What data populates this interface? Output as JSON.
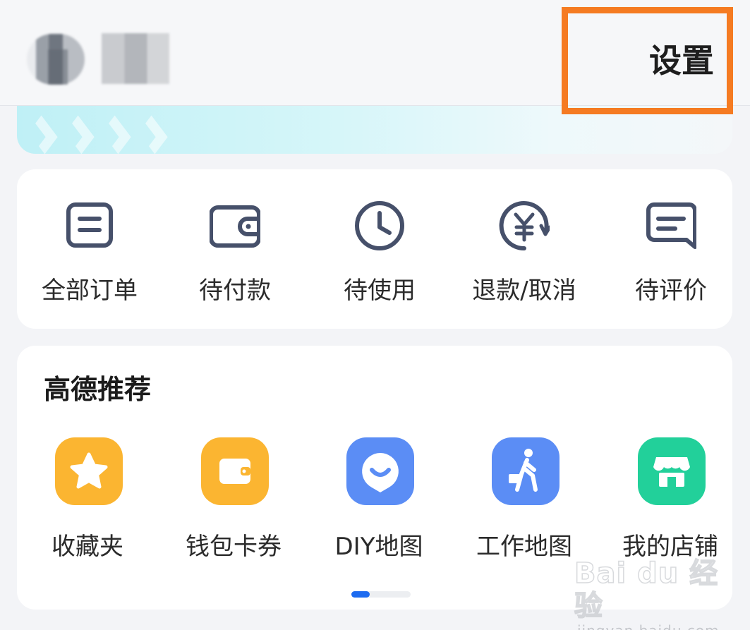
{
  "header": {
    "settings_label": "设置"
  },
  "orders": {
    "items": [
      {
        "label": "全部订单",
        "icon": "order-list-icon"
      },
      {
        "label": "待付款",
        "icon": "wallet-icon"
      },
      {
        "label": "待使用",
        "icon": "clock-icon"
      },
      {
        "label": "退款/取消",
        "icon": "yuan-refund-icon"
      },
      {
        "label": "待评价",
        "icon": "comment-icon"
      }
    ]
  },
  "recommend": {
    "title": "高德推荐",
    "items": [
      {
        "label": "收藏夹",
        "icon": "star-icon",
        "color": "#fbb531"
      },
      {
        "label": "钱包卡券",
        "icon": "wallet-card-icon",
        "color": "#fbb531"
      },
      {
        "label": "DIY地图",
        "icon": "smile-pin-icon",
        "color": "#5b8df5"
      },
      {
        "label": "工作地图",
        "icon": "walker-briefcase-icon",
        "color": "#5b8df5"
      },
      {
        "label": "我的店铺",
        "icon": "shop-icon",
        "color": "#22d09a"
      }
    ],
    "pager": {
      "pages": 2,
      "active": 1
    }
  },
  "colors": {
    "highlight": "#f57b22",
    "icon_stroke": "#46506a",
    "pager_active": "#1d6bf0"
  },
  "watermark": {
    "main": "Bai du 经验",
    "sub": "jingyan.baidu.com"
  }
}
